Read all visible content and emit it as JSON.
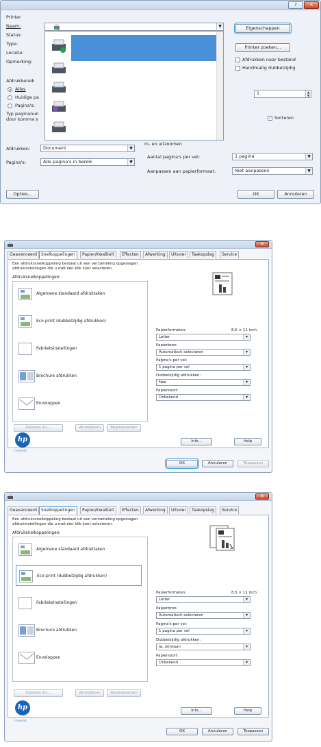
{
  "d1": {
    "title_buttons": {
      "help": "?",
      "close": "✕"
    },
    "printer_group": "Printer",
    "labels": {
      "name": "Naam:",
      "status": "Status:",
      "type": "Type:",
      "location": "Locatie:",
      "comment": "Opmerking:"
    },
    "buttons": {
      "properties": "Eigenschappen",
      "find_printer": "Printer zoeken..."
    },
    "checks": {
      "print_to_file": "Afdrukken naar bestand",
      "manual_duplex": "Handmatig dubbelzijdig"
    },
    "range_group": "Afdrukbereik",
    "range": {
      "all": "Alles",
      "current": "Huidige pa",
      "pages": "Pagina's:",
      "hint1": "Typ paginanun",
      "hint2": "door komma s"
    },
    "copies_value": "1",
    "collate": "Sorteren",
    "check_mark": "✓",
    "print_what_label": "Afdrukken:",
    "print_what_value": "Document",
    "pages_label": "Pagina's:",
    "pages_value": "Alle pagina's in bereik",
    "zoom_group": "In- en uitzoomen",
    "pps_label": "Aantal pagina's per vel:",
    "pps_value": "1 pagina",
    "scale_label": "Aanpassen aan papierformaat:",
    "scale_value": "Niet aanpassen",
    "options": "Opties...",
    "ok": "OK",
    "cancel": "Annuleren",
    "dd_arrow": "▼"
  },
  "d2": {
    "close": "✕",
    "tabs": [
      "Geavanceerd",
      "Snelkoppelingen",
      "Papier/Kwaliteit",
      "Effecten",
      "Afwerking",
      "Uitvoer",
      "Taakopslag",
      "Service"
    ],
    "desc1": "Een afdrukssnelkoppeling bestaat uit een verzameling opgeslagen",
    "desc2": "afdrukinstellingen die u met één klik kunt selecteren.",
    "list_label": "Afdruksnelkoppelingen:",
    "shortcuts": [
      "Algemene standaard afdruktaken",
      "Eco-print (dubbelzijdig afdrukken)",
      "Fabrieksinstellingen",
      "Brochure afdrukken",
      "Enveloppen"
    ],
    "paper_size_label": "Papierformaten:",
    "paper_size_dims": "8,5 × 11 inch",
    "paper_size_value": "Letter",
    "source_label": "Papierbron:",
    "source_value": "Automatisch selecteren",
    "pps_label": "Pagina's per vel:",
    "pps_value": "1 pagina per vel",
    "duplex_label": "Dubbelzijdig afdrukken:",
    "duplex_value": "Nee",
    "type_label": "Papiersoort:",
    "type_value": "Onbekend",
    "save_as": "Opslaan als...",
    "delete": "Verwijderen",
    "defaults": "Beginwaarden",
    "info": "Info...",
    "help": "Help",
    "ok": "OK",
    "cancel": "Annuleren",
    "apply": "Toepassen",
    "hp_sub": "invent"
  },
  "d3": {
    "close": "✕",
    "tabs": [
      "Geavanceerd",
      "Snelkoppelingen",
      "Papier/Kwaliteit",
      "Effecten",
      "Afwerking",
      "Uitvoer",
      "Taakopslag",
      "Service"
    ],
    "desc1": "Een afdrukssnelkoppeling bestaat uit een verzameling opgeslagen",
    "desc2": "afdrukinstellingen die u met één klik kunt selecteren.",
    "list_label": "Afdruksnelkoppelingen:",
    "shortcuts": [
      "Algemene standaard afdruktaken",
      "Eco-print (dubbelzijdig afdrukken)",
      "Fabrieksinstellingen",
      "Brochure afdrukken",
      "Enveloppen"
    ],
    "paper_size_label": "Papierformaten:",
    "paper_size_dims": "8,5 × 11 inch",
    "paper_size_value": "Letter",
    "source_label": "Papierbron:",
    "source_value": "Automatisch selecteren",
    "pps_label": "Pagina's per vel:",
    "pps_value": "1 pagina per vel",
    "duplex_label": "Dubbelzijdig afdrukken:",
    "duplex_value": "Ja, omslaan",
    "type_label": "Papiersoort:",
    "type_value": "Onbekend",
    "save_as": "Opslaan als...",
    "delete": "Verwijderen",
    "defaults": "Beginwaarden",
    "info": "Info...",
    "help": "Help",
    "ok": "OK",
    "cancel": "Annuleren",
    "apply": "Toepassen",
    "hp_sub": "invent"
  }
}
